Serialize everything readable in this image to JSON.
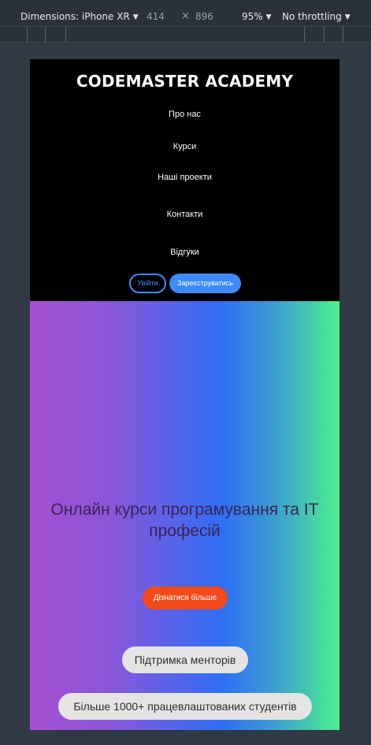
{
  "devtools": {
    "device_label": "Dimensions: iPhone XR",
    "width": "414",
    "times": "×",
    "height": "896",
    "zoom": "95%",
    "throttling": "No throttling",
    "dropdown_glyph": "▼"
  },
  "site": {
    "brand": "CODEMASTER ACADEMY",
    "nav": {
      "about": "Про нас",
      "courses": "Курси",
      "projects": "Наші проекти",
      "contacts": "Контакти",
      "reviews": "Відгуки"
    },
    "login_label": "Увійти",
    "register_label": "Зареєструватись",
    "hero": {
      "title": "Онлайн курси програмування та IT професій",
      "cta_label": "Дізнатися більше",
      "features": [
        "Підтримка менторів",
        "Більше 1000+ працевлаштованих студентів"
      ]
    }
  },
  "colors": {
    "accent_blue": "#3d8bff",
    "cta_orange": "#f24a1b",
    "gradient_start": "#a44fcf",
    "gradient_mid": "#2f6ef6",
    "gradient_end": "#4df08d"
  }
}
